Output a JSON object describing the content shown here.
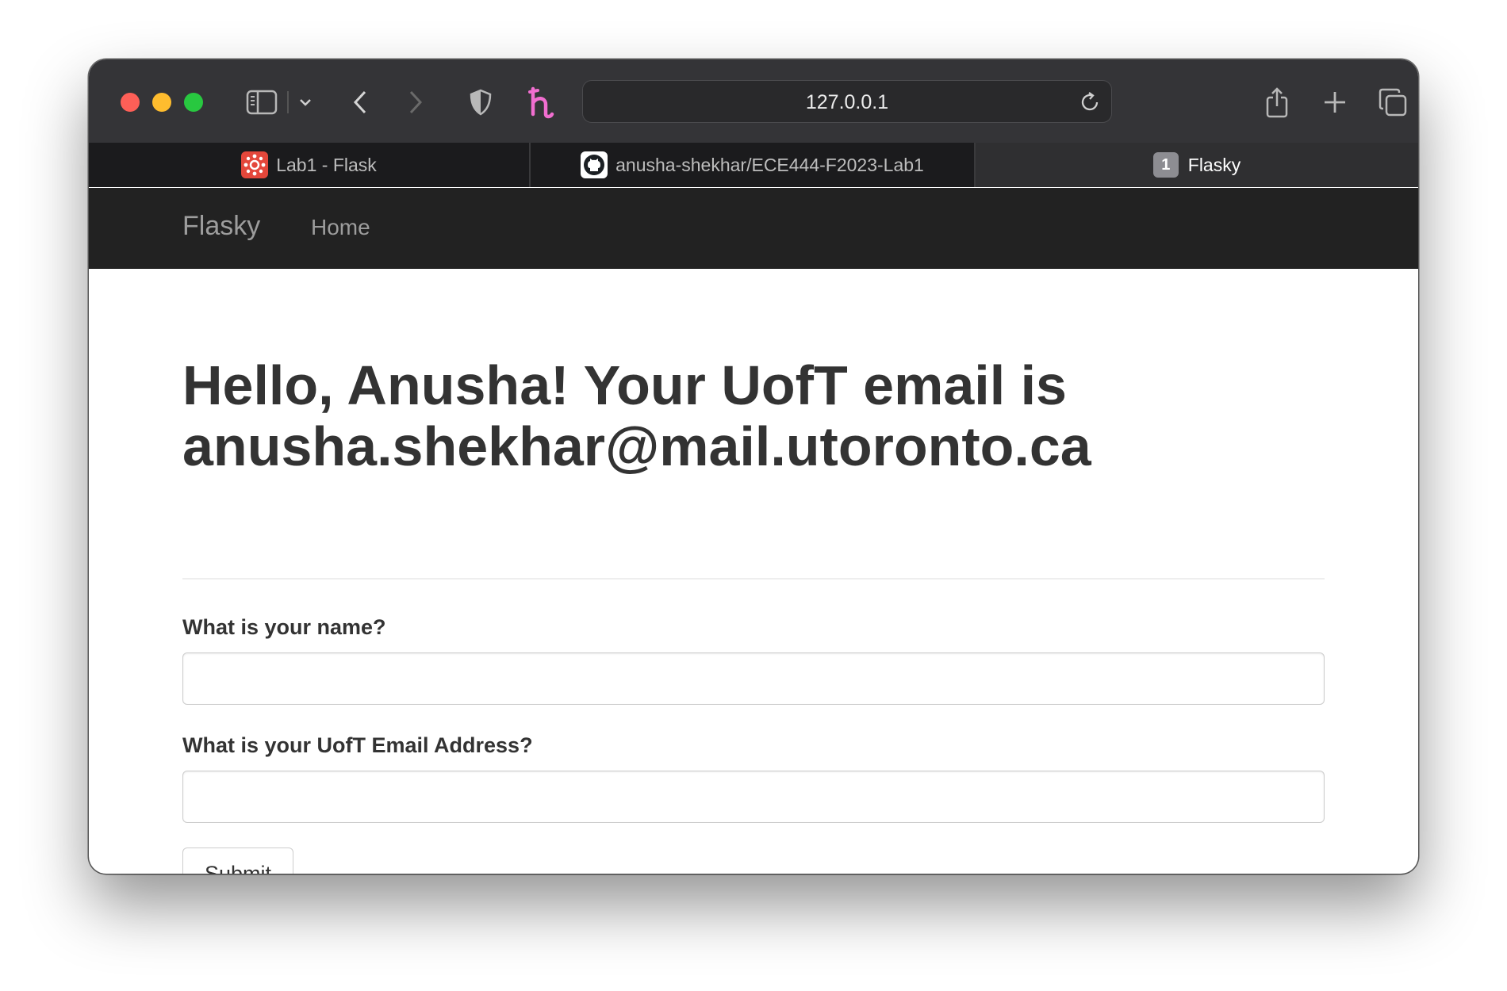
{
  "browser": {
    "url": "127.0.0.1",
    "tabs": [
      {
        "label": "Lab1 - Flask",
        "icon": "canvas-icon",
        "active": false
      },
      {
        "label": "anusha-shekhar/ECE444-F2023-Lab1",
        "icon": "github-icon",
        "active": false
      },
      {
        "label": "Flasky",
        "badge": "1",
        "active": true
      }
    ],
    "extension_icon": "honey-icon",
    "colors": {
      "close": "#fe5f57",
      "minimize": "#febc2e",
      "zoom": "#28c840",
      "honey_accent": "#f16ed0"
    }
  },
  "navbar": {
    "brand": "Flasky",
    "links": [
      {
        "label": "Home"
      }
    ]
  },
  "main": {
    "greeting_line1": "Hello, Anusha! Your UofT email is",
    "greeting_line2": "anusha.shekhar@mail.utoronto.ca",
    "form": {
      "name_label": "What is your name?",
      "name_value": "",
      "email_label": "What is your UofT Email Address?",
      "email_value": "",
      "submit_label": "Submit"
    }
  }
}
